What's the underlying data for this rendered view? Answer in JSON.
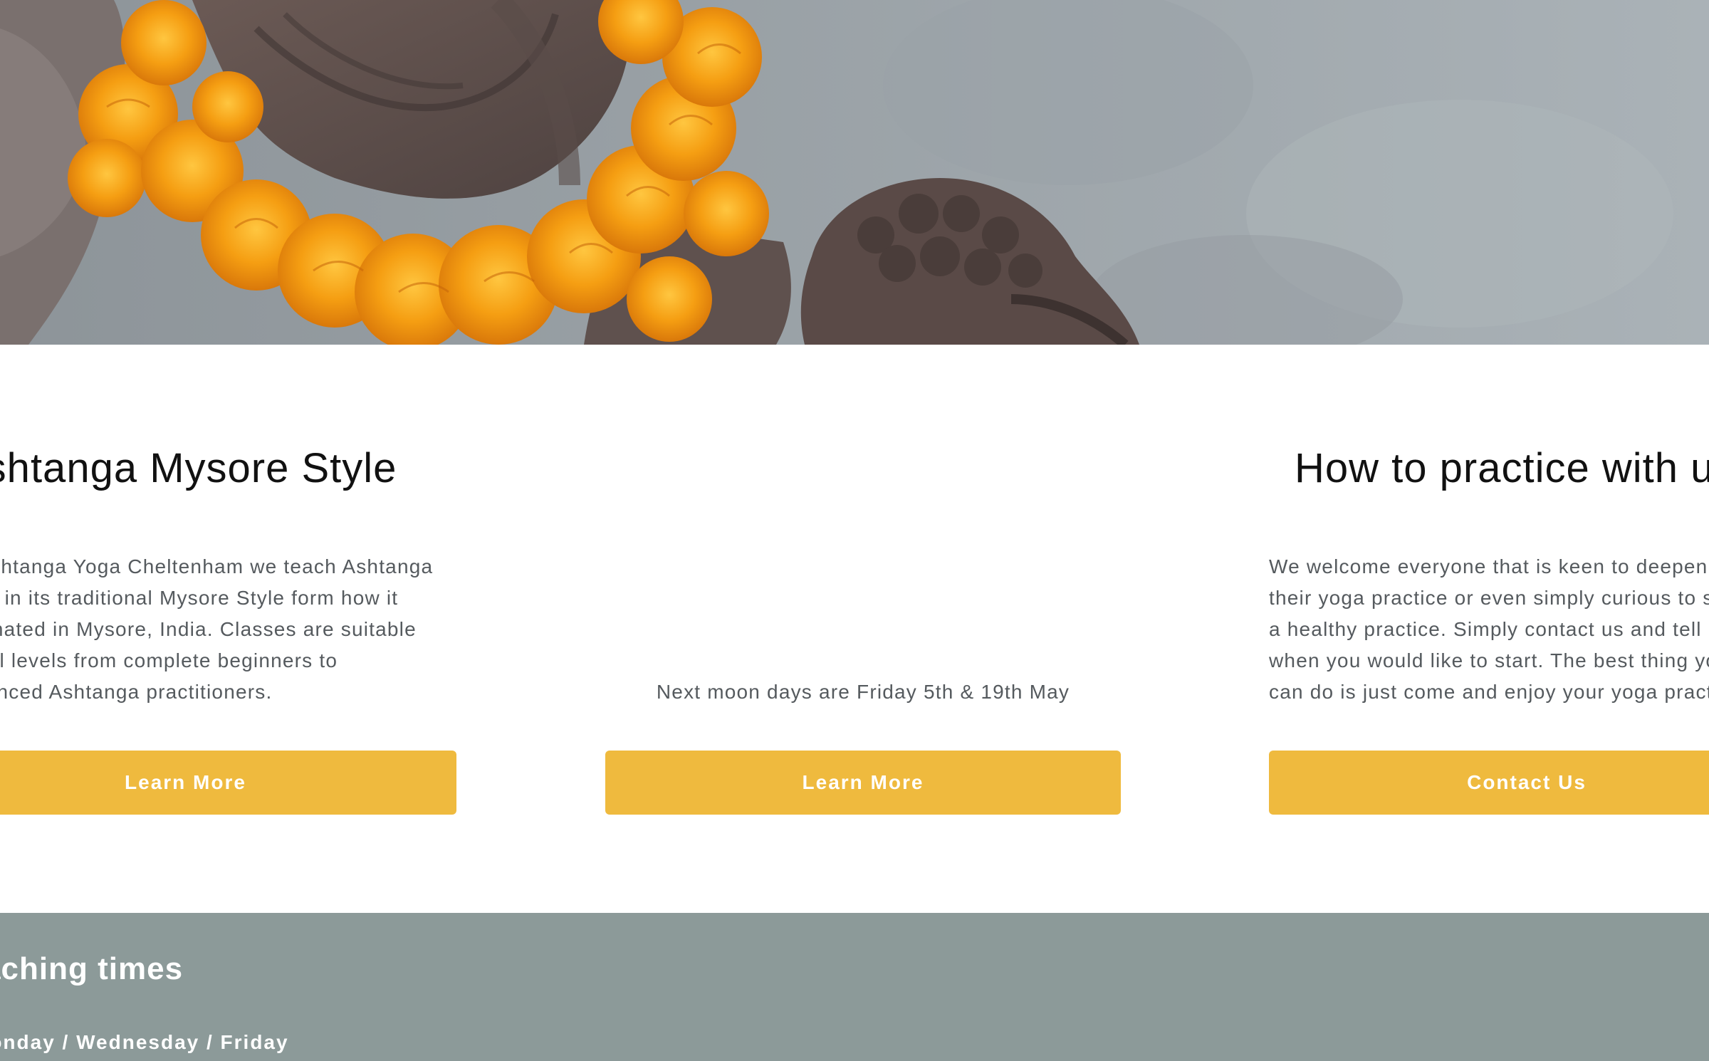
{
  "hero": {
    "image": "ganesha-statue-with-marigold-garland"
  },
  "columns": [
    {
      "title": "Ashtanga Mysore Style",
      "lines": [
        "At Ashtanga Yoga Cheltenham we teach Ashtanga",
        "Yoga in its traditional Mysore Style form how it",
        "originated in Mysore, India. Classes are suitable",
        "for all levels from complete beginners to",
        "advanced Ashtanga practitioners."
      ],
      "button_label": "Learn More"
    },
    {
      "title": "",
      "lines": [
        "Next moon days are Friday 5th & 19th May"
      ],
      "button_label": "Learn More"
    },
    {
      "title": "How to practice with us",
      "lines": [
        "We welcome everyone that is keen to deepen",
        "their yoga practice or even simply curious to start",
        "a healthy practice. Simply contact us and tell us",
        "when you would like to start. The best thing you",
        "can do is just come and enjoy your yoga practice."
      ],
      "button_label": "Contact Us"
    }
  ],
  "teaching": {
    "title": "Teaching times",
    "days": "Monday / Wednesday / Friday"
  },
  "colors": {
    "button": "#efba3e",
    "band": "#8c9a99",
    "marigold": "#f3a21b"
  }
}
